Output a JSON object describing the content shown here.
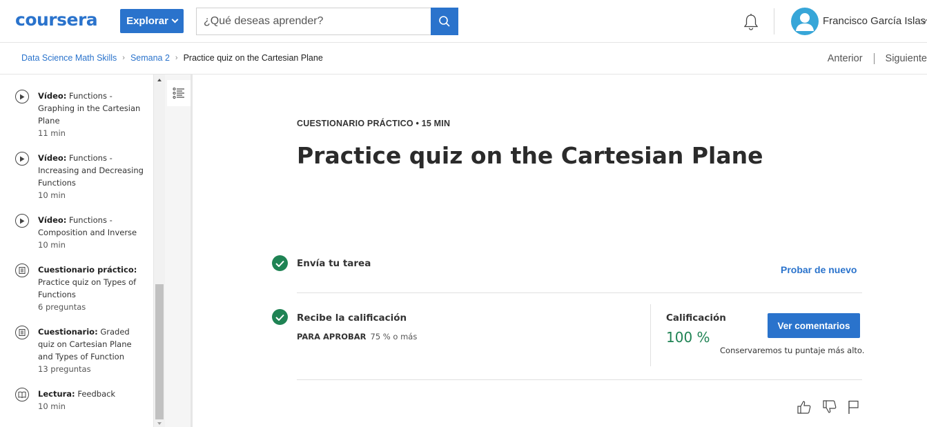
{
  "header": {
    "logo": "coursera",
    "explore_label": "Explorar",
    "search_placeholder": "¿Qué deseas aprender?",
    "user_name": "Francisco García Islas"
  },
  "breadcrumb": {
    "items": [
      "Data Science Math Skills",
      "Semana 2"
    ],
    "current": "Practice quiz on the Cartesian Plane"
  },
  "nav": {
    "prev": "Anterior",
    "next": "Siguiente"
  },
  "sidebar": {
    "items": [
      {
        "type": "Vídeo:",
        "title": "Functions - Graphing in the Cartesian Plane",
        "meta": "11 min",
        "icon": "play-icon"
      },
      {
        "type": "Vídeo:",
        "title": "Functions - Increasing and Decreasing Functions",
        "meta": "10 min",
        "icon": "play-icon"
      },
      {
        "type": "Vídeo:",
        "title": "Functions - Composition and Inverse",
        "meta": "10 min",
        "icon": "play-icon"
      },
      {
        "type": "Cuestionario práctico:",
        "title": "Practice quiz on Types of Functions",
        "meta": "6 preguntas",
        "icon": "quiz-icon"
      },
      {
        "type": "Cuestionario:",
        "title": "Graded quiz on Cartesian Plane and Types of Function",
        "meta": "13 preguntas",
        "icon": "quiz-icon"
      },
      {
        "type": "Lectura:",
        "title": "Feedback",
        "meta": "10 min",
        "icon": "book-icon"
      }
    ]
  },
  "main": {
    "eyebrow": "CUESTIONARIO PRÁCTICO • 15 MIN",
    "title": "Practice quiz on the Cartesian Plane",
    "step1": "Envía tu tarea",
    "retry": "Probar de nuevo",
    "step2": "Recibe la calificación",
    "pass_label": "PARA APROBAR",
    "pass_value": "75 % o más",
    "grade_label": "Calificación",
    "grade_value": "100 %",
    "feedback_button": "Ver comentarios",
    "keep_note": "Conservaremos tu puntaje más alto."
  },
  "colors": {
    "brand": "#2a73cc",
    "success": "#1f8354"
  }
}
